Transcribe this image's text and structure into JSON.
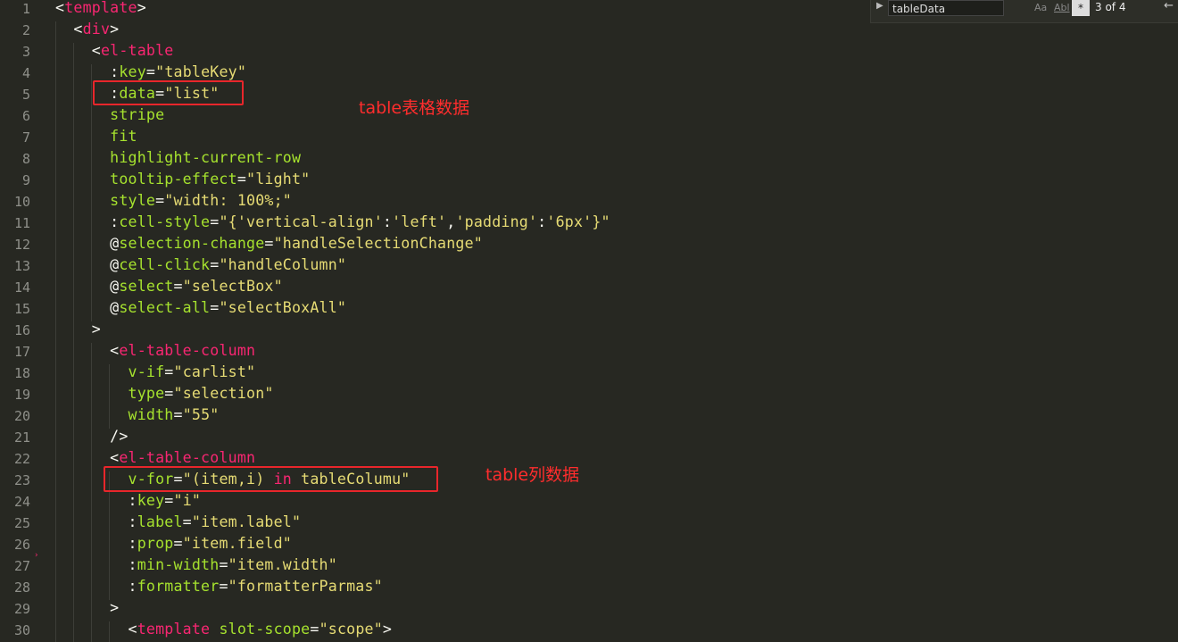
{
  "editor": {
    "line_numbers": [
      "1",
      "2",
      "3",
      "4",
      "5",
      "6",
      "7",
      "8",
      "9",
      "10",
      "11",
      "12",
      "13",
      "14",
      "15",
      "16",
      "17",
      "18",
      "19",
      "20",
      "21",
      "22",
      "23",
      "24",
      "25",
      "26",
      "27",
      "28",
      "29",
      "30"
    ],
    "lines": [
      [
        {
          "c": "p",
          "t": "<"
        },
        {
          "c": "t",
          "t": "template"
        },
        {
          "c": "p",
          "t": ">"
        }
      ],
      [
        {
          "c": "p",
          "t": "  <"
        },
        {
          "c": "t",
          "t": "div"
        },
        {
          "c": "p",
          "t": ">"
        }
      ],
      [
        {
          "c": "p",
          "t": "    <"
        },
        {
          "c": "t",
          "t": "el-table"
        }
      ],
      [
        {
          "c": "p",
          "t": "      :"
        },
        {
          "c": "a",
          "t": "key"
        },
        {
          "c": "p",
          "t": "="
        },
        {
          "c": "s",
          "t": "\"tableKey\""
        }
      ],
      [
        {
          "c": "p",
          "t": "      :"
        },
        {
          "c": "a",
          "t": "data"
        },
        {
          "c": "p",
          "t": "="
        },
        {
          "c": "s",
          "t": "\"list\""
        }
      ],
      [
        {
          "c": "a",
          "t": "      stripe"
        }
      ],
      [
        {
          "c": "a",
          "t": "      fit"
        }
      ],
      [
        {
          "c": "a",
          "t": "      highlight-current-row"
        }
      ],
      [
        {
          "c": "a",
          "t": "      tooltip-effect"
        },
        {
          "c": "p",
          "t": "="
        },
        {
          "c": "s",
          "t": "\"light\""
        }
      ],
      [
        {
          "c": "a",
          "t": "      style"
        },
        {
          "c": "p",
          "t": "="
        },
        {
          "c": "s",
          "t": "\"width: 100%;\""
        }
      ],
      [
        {
          "c": "p",
          "t": "      :"
        },
        {
          "c": "a",
          "t": "cell-style"
        },
        {
          "c": "p",
          "t": "="
        },
        {
          "c": "s",
          "t": "\"{"
        },
        {
          "c": "s",
          "t": "'vertical-align'"
        },
        {
          "c": "p",
          "t": ":"
        },
        {
          "c": "s",
          "t": "'left'"
        },
        {
          "c": "p",
          "t": ","
        },
        {
          "c": "s",
          "t": "'padding'"
        },
        {
          "c": "p",
          "t": ":"
        },
        {
          "c": "s",
          "t": "'6px'"
        },
        {
          "c": "s",
          "t": "}\""
        }
      ],
      [
        {
          "c": "p",
          "t": "      @"
        },
        {
          "c": "a",
          "t": "selection-change"
        },
        {
          "c": "p",
          "t": "="
        },
        {
          "c": "s",
          "t": "\"handleSelectionChange\""
        }
      ],
      [
        {
          "c": "p",
          "t": "      @"
        },
        {
          "c": "a",
          "t": "cell-click"
        },
        {
          "c": "p",
          "t": "="
        },
        {
          "c": "s",
          "t": "\"handleColumn\""
        }
      ],
      [
        {
          "c": "p",
          "t": "      @"
        },
        {
          "c": "a",
          "t": "select"
        },
        {
          "c": "p",
          "t": "="
        },
        {
          "c": "s",
          "t": "\"selectBox\""
        }
      ],
      [
        {
          "c": "p",
          "t": "      @"
        },
        {
          "c": "a",
          "t": "select-all"
        },
        {
          "c": "p",
          "t": "="
        },
        {
          "c": "s",
          "t": "\"selectBoxAll\""
        }
      ],
      [
        {
          "c": "p",
          "t": "    >"
        }
      ],
      [
        {
          "c": "p",
          "t": "      <"
        },
        {
          "c": "t",
          "t": "el-table-column"
        }
      ],
      [
        {
          "c": "a",
          "t": "        v-if"
        },
        {
          "c": "p",
          "t": "="
        },
        {
          "c": "s",
          "t": "\"carlist\""
        }
      ],
      [
        {
          "c": "a",
          "t": "        type"
        },
        {
          "c": "p",
          "t": "="
        },
        {
          "c": "s",
          "t": "\"selection\""
        }
      ],
      [
        {
          "c": "a",
          "t": "        width"
        },
        {
          "c": "p",
          "t": "="
        },
        {
          "c": "s",
          "t": "\"55\""
        }
      ],
      [
        {
          "c": "p",
          "t": "      />"
        }
      ],
      [
        {
          "c": "p",
          "t": "      <"
        },
        {
          "c": "t",
          "t": "el-table-column"
        }
      ],
      [
        {
          "c": "a",
          "t": "        v-for"
        },
        {
          "c": "p",
          "t": "="
        },
        {
          "c": "s",
          "t": "\"(item,i) "
        },
        {
          "c": "t",
          "t": "in"
        },
        {
          "c": "s",
          "t": " tableColumu\""
        }
      ],
      [
        {
          "c": "p",
          "t": "        :"
        },
        {
          "c": "a",
          "t": "key"
        },
        {
          "c": "p",
          "t": "="
        },
        {
          "c": "s",
          "t": "\"i\""
        }
      ],
      [
        {
          "c": "p",
          "t": "        :"
        },
        {
          "c": "a",
          "t": "label"
        },
        {
          "c": "p",
          "t": "="
        },
        {
          "c": "s",
          "t": "\"item.label\""
        }
      ],
      [
        {
          "c": "p",
          "t": "        :"
        },
        {
          "c": "a",
          "t": "prop"
        },
        {
          "c": "p",
          "t": "="
        },
        {
          "c": "s",
          "t": "\"item.field\""
        }
      ],
      [
        {
          "c": "p",
          "t": "        :"
        },
        {
          "c": "a",
          "t": "min-width"
        },
        {
          "c": "p",
          "t": "="
        },
        {
          "c": "s",
          "t": "\"item.width\""
        }
      ],
      [
        {
          "c": "p",
          "t": "        :"
        },
        {
          "c": "a",
          "t": "formatter"
        },
        {
          "c": "p",
          "t": "="
        },
        {
          "c": "s",
          "t": "\"formatterParmas\""
        }
      ],
      [
        {
          "c": "p",
          "t": "      >"
        }
      ],
      [
        {
          "c": "p",
          "t": "        <"
        },
        {
          "c": "t",
          "t": "template"
        },
        {
          "c": "p",
          "t": " "
        },
        {
          "c": "a",
          "t": "slot-scope"
        },
        {
          "c": "p",
          "t": "="
        },
        {
          "c": "s",
          "t": "\"scope\""
        },
        {
          "c": "p",
          "t": ">"
        }
      ]
    ]
  },
  "annotations": {
    "data_note": "table表格数据",
    "column_note": "table列数据"
  },
  "find_bar": {
    "query": "tableData",
    "case_label": "Aa",
    "word_label": "Abl",
    "regex_label": "*",
    "count": "3 of 4",
    "back_icon": "←"
  },
  "colors": {
    "background": "#272822",
    "tag": "#f92672",
    "attribute": "#a6e22e",
    "string": "#e6db74",
    "highlight_box": "#e8262b"
  }
}
